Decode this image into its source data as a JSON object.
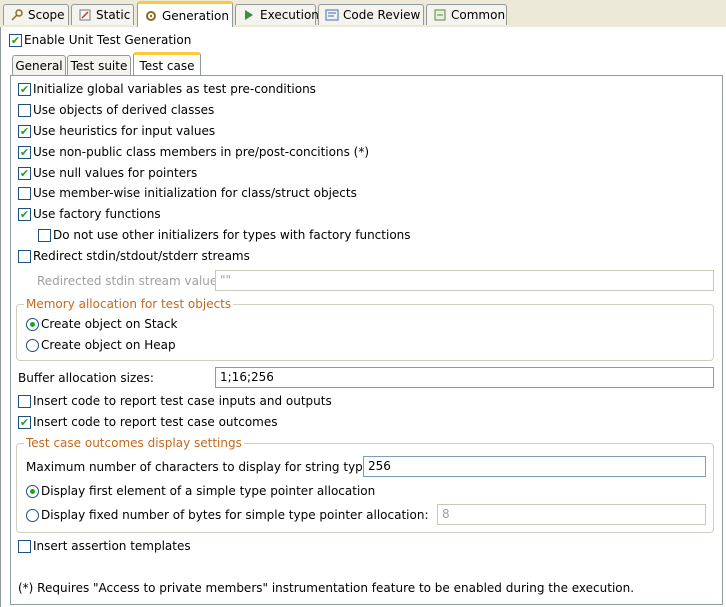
{
  "tabs": [
    {
      "label": "Scope",
      "icon": "key-icon"
    },
    {
      "label": "Static",
      "icon": "static-icon"
    },
    {
      "label": "Generation",
      "icon": "gear-icon"
    },
    {
      "label": "Execution",
      "icon": "execution-icon"
    },
    {
      "label": "Code Review",
      "icon": "code-review-icon"
    },
    {
      "label": "Common",
      "icon": "common-icon"
    }
  ],
  "enable_unit_test": {
    "label": "Enable Unit Test Generation",
    "checked": true
  },
  "inner_tabs": [
    "General",
    "Test suite",
    "Test case"
  ],
  "options": [
    {
      "label": "Initialize global variables as test pre-conditions",
      "checked": true
    },
    {
      "label": "Use objects of derived classes",
      "checked": false
    },
    {
      "label": "Use heuristics for input values",
      "checked": true
    },
    {
      "label": "Use non-public class members in pre/post-concitions (*)",
      "checked": true
    },
    {
      "label": "Use null values for pointers",
      "checked": true
    },
    {
      "label": "Use member-wise initialization for class/struct objects",
      "checked": false
    },
    {
      "label": "Use factory functions",
      "checked": true
    },
    {
      "label": "Do not use other initializers for types with factory functions",
      "checked": false
    },
    {
      "label": "Redirect stdin/stdout/stderr streams",
      "checked": false
    }
  ],
  "redirect_stdin": {
    "label": "Redirected stdin stream value",
    "value": "\"\""
  },
  "memory_group": {
    "title": "Memory allocation for test objects",
    "options": [
      {
        "label": "Create object on Stack",
        "selected": true
      },
      {
        "label": "Create object on Heap",
        "selected": false
      }
    ]
  },
  "buffer": {
    "label": "Buffer allocation sizes:",
    "value": "1;16;256"
  },
  "report": [
    {
      "label": "Insert code to report test case inputs and outputs",
      "checked": false
    },
    {
      "label": "Insert code to report test case outcomes",
      "checked": true
    }
  ],
  "outcomes_group": {
    "title": "Test case outcomes display settings",
    "max_chars_label": "Maximum number of characters to display for string types:",
    "max_chars_value": "256",
    "options": [
      {
        "label": "Display first element of a simple type pointer allocation",
        "selected": true
      },
      {
        "label": "Display fixed number of bytes for simple type pointer allocation:",
        "selected": false
      }
    ],
    "fixed_bytes_value": "8"
  },
  "assertion": {
    "label": "Insert assertion templates",
    "checked": false
  },
  "footnote": "(*) Requires \"Access to private members\" instrumentation feature to be enabled during the execution."
}
